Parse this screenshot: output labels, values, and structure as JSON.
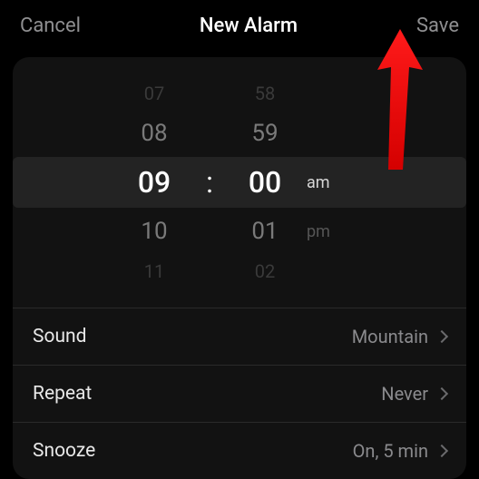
{
  "header": {
    "cancel_label": "Cancel",
    "title": "New Alarm",
    "save_label": "Save"
  },
  "picker": {
    "rows": [
      {
        "h": "07",
        "m": "58",
        "ampm": ""
      },
      {
        "h": "08",
        "m": "59",
        "ampm": ""
      },
      {
        "h": "09",
        "m": "00",
        "ampm": "am"
      },
      {
        "h": "10",
        "m": "01",
        "ampm": "pm"
      },
      {
        "h": "11",
        "m": "02",
        "ampm": ""
      }
    ],
    "colon": ":"
  },
  "settings": {
    "sound": {
      "label": "Sound",
      "value": "Mountain"
    },
    "repeat": {
      "label": "Repeat",
      "value": "Never"
    },
    "snooze": {
      "label": "Snooze",
      "value": "On, 5 min"
    }
  }
}
